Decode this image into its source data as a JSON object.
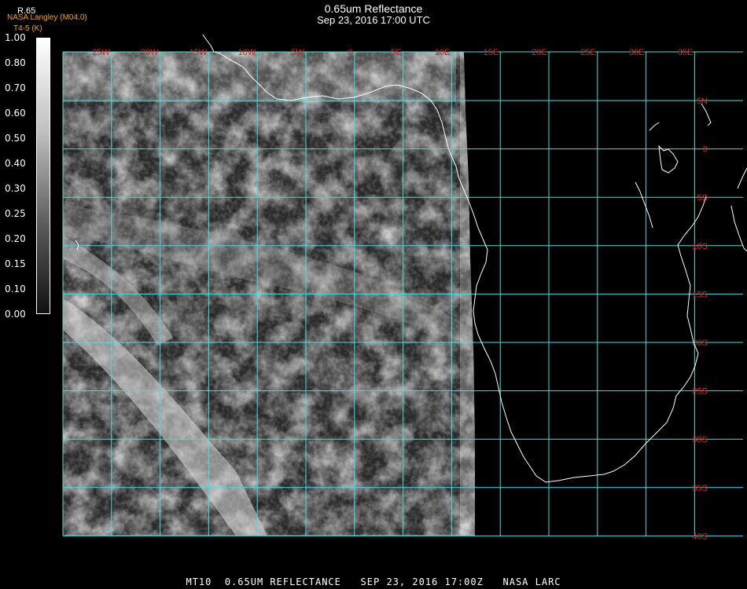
{
  "header": {
    "title": "0.65um Reflectance",
    "subtitle": "Sep 23, 2016 17:00 UTC",
    "credit": "NASA Langley (M04.0)",
    "credit2": "T4-5 (K)",
    "unit": "R.65"
  },
  "colorbar": {
    "ticks": [
      "1.00",
      "0.80",
      "0.70",
      "0.60",
      "0.50",
      "0.40",
      "0.30",
      "0.25",
      "0.20",
      "0.15",
      "0.10",
      "0.00"
    ]
  },
  "map": {
    "lon_labels": [
      "25W",
      "20W",
      "15W",
      "10W",
      "5W",
      "0",
      "5E",
      "10E",
      "15E",
      "20E",
      "25E",
      "30E",
      "35E"
    ],
    "lat_labels": [
      "5N",
      "0",
      "5S",
      "10S",
      "15S",
      "20S",
      "25S",
      "30S",
      "35S",
      "40S"
    ],
    "grid_color": "#40e0e0",
    "label_color": "#e02020"
  },
  "footer": {
    "caption": "MT10  0.65UM REFLECTANCE   SEP 23, 2016 17:00Z   NASA LARC"
  }
}
